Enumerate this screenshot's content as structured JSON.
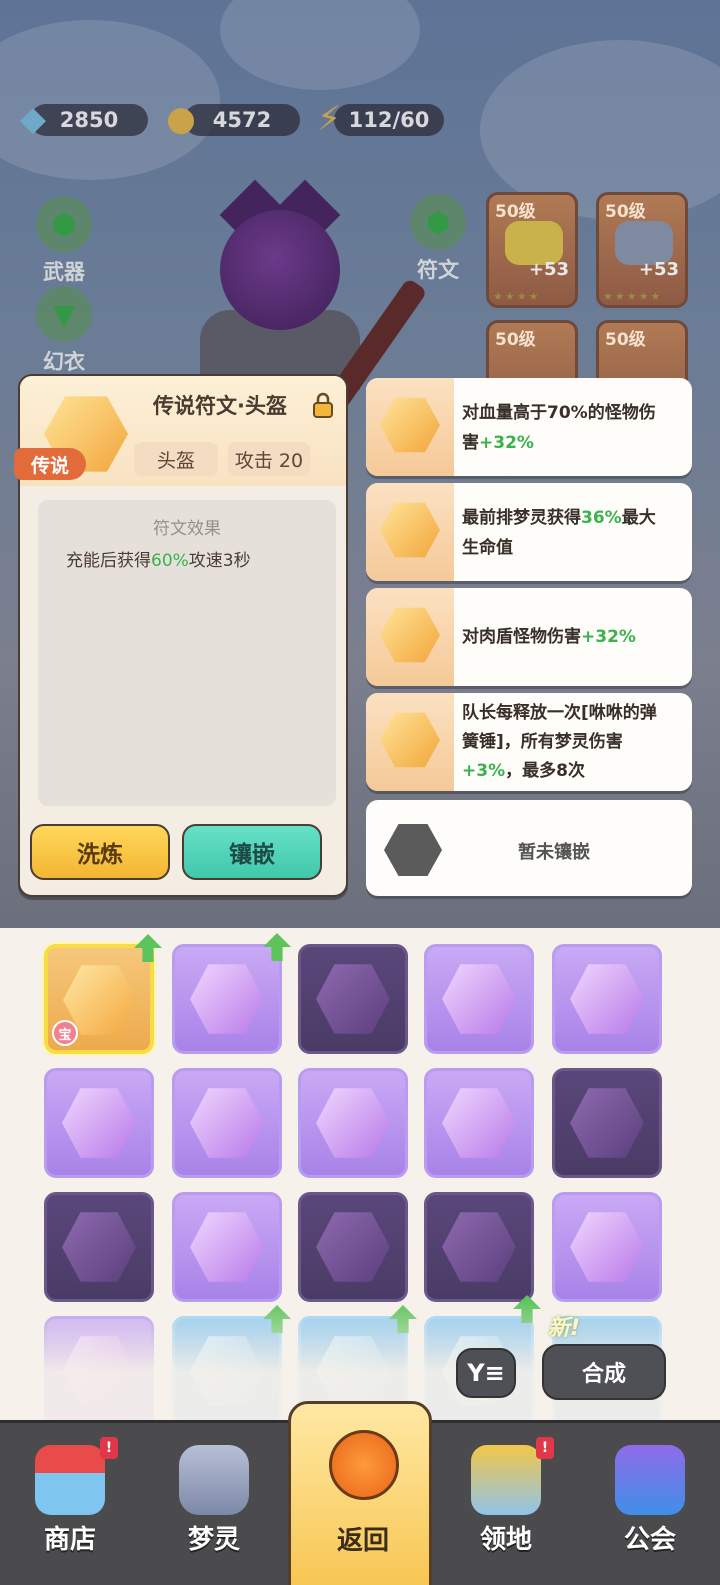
{
  "resources": {
    "gems": "2850",
    "coins": "4572",
    "energy": "112/60"
  },
  "side_buttons": [
    "武器",
    "幻衣",
    "符文"
  ],
  "equipment": [
    {
      "level": "50级",
      "plus": "+53"
    },
    {
      "level": "50级",
      "plus": "+53"
    },
    {
      "level": "50级"
    },
    {
      "level": "50级"
    }
  ],
  "detail": {
    "title": "传说符文·头盔",
    "rarity": "传说",
    "slot_tag": "头盔",
    "attack_tag": "攻击 20",
    "effect_title": "符文效果",
    "effect_prefix": "充能后获得",
    "effect_value": "60%",
    "effect_suffix": "攻速3秒",
    "refine_button": "洗炼",
    "inlay_button": "镶嵌"
  },
  "bonuses": [
    {
      "line1_prefix": "对血量高于70%的怪物伤",
      "line2_prefix": "害",
      "value": "+32%",
      "line2_suffix": ""
    },
    {
      "line1_prefix": "最前排梦灵获得",
      "line1_value": "36%",
      "line1_suffix": "最大",
      "line2": "生命值"
    },
    {
      "prefix": "对肉盾怪物伤害",
      "value": "+32%"
    },
    {
      "line1": "队长每释放一次[咻咻的弹",
      "line2": "簧锤]，所有梦灵伤害",
      "value": "+3%",
      "line3_suffix": "，最多8次"
    }
  ],
  "empty_slot_label": "暂未镶嵌",
  "inventory": {
    "badge": "宝",
    "new_label": "新!",
    "filter_icon_label": "Y≡",
    "merge_button": "合成"
  },
  "nav": {
    "shop": "商店",
    "spirit": "梦灵",
    "back": "返回",
    "territory": "领地",
    "guild": "公会",
    "badge": "!"
  },
  "colors": {
    "accent_green": "#3bb24c",
    "legend_orange": "#e26b3c",
    "purple_rune": "#a883e8",
    "gold_rune": "#eeaa4c"
  }
}
